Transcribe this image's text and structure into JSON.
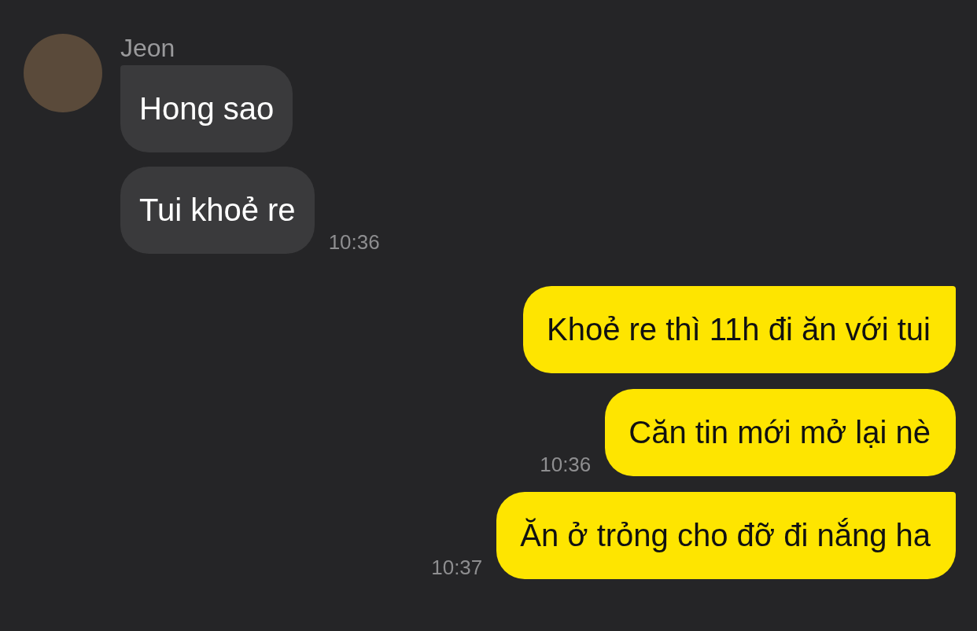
{
  "contact": {
    "name": "Jeon"
  },
  "messages": [
    {
      "kind": "incoming",
      "text": "Hong sao",
      "tail": true
    },
    {
      "kind": "incoming",
      "text": "Tui khoẻ re",
      "tail": false,
      "time": "10:36"
    },
    {
      "kind": "outgoing",
      "text": "Khoẻ re thì 11h đi ăn với tui",
      "tail": true
    },
    {
      "kind": "outgoing",
      "text": "Căn tin mới mở lại nè",
      "tail": false,
      "time": "10:36"
    },
    {
      "kind": "outgoing",
      "text": "Ăn ở trỏng cho đỡ đi nắng ha",
      "tail": true,
      "time": "10:37"
    }
  ]
}
